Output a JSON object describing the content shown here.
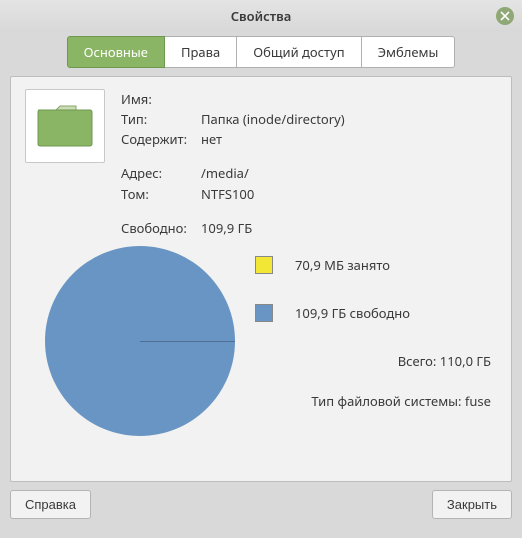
{
  "window": {
    "title": "Свойства"
  },
  "tabs": {
    "basic": "Основные",
    "permissions": "Права",
    "share": "Общий доступ",
    "emblems": "Эмблемы"
  },
  "labels": {
    "name": "Имя:",
    "type": "Тип:",
    "contains": "Содержит:",
    "address": "Адрес:",
    "volume": "Том:",
    "free": "Свободно:"
  },
  "values": {
    "name": "",
    "type": "Папка (inode/directory)",
    "contains": "нет",
    "address": "/media/",
    "volume": "NTFS100",
    "free": "109,9 ГБ"
  },
  "legend": {
    "used": "70,9 МБ занято",
    "free": "109,9 ГБ свободно",
    "total_label": "Всего:",
    "total_value": "110,0 ГБ",
    "fs_label": "Тип файловой системы:",
    "fs_value": "fuse"
  },
  "buttons": {
    "help": "Справка",
    "close": "Закрыть"
  },
  "colors": {
    "accent": "#8ab565",
    "pie_free": "#6995c4",
    "pie_used": "#f2e735"
  },
  "chart_data": {
    "type": "pie",
    "title": "",
    "series": [
      {
        "name": "занято",
        "value_label": "70,9 МБ",
        "value_mb": 70.9,
        "color": "#f2e735"
      },
      {
        "name": "свободно",
        "value_label": "109,9 ГБ",
        "value_mb": 112537.6,
        "color": "#6995c4"
      }
    ],
    "total": {
      "label": "110,0 ГБ",
      "value_mb": 112640
    }
  }
}
